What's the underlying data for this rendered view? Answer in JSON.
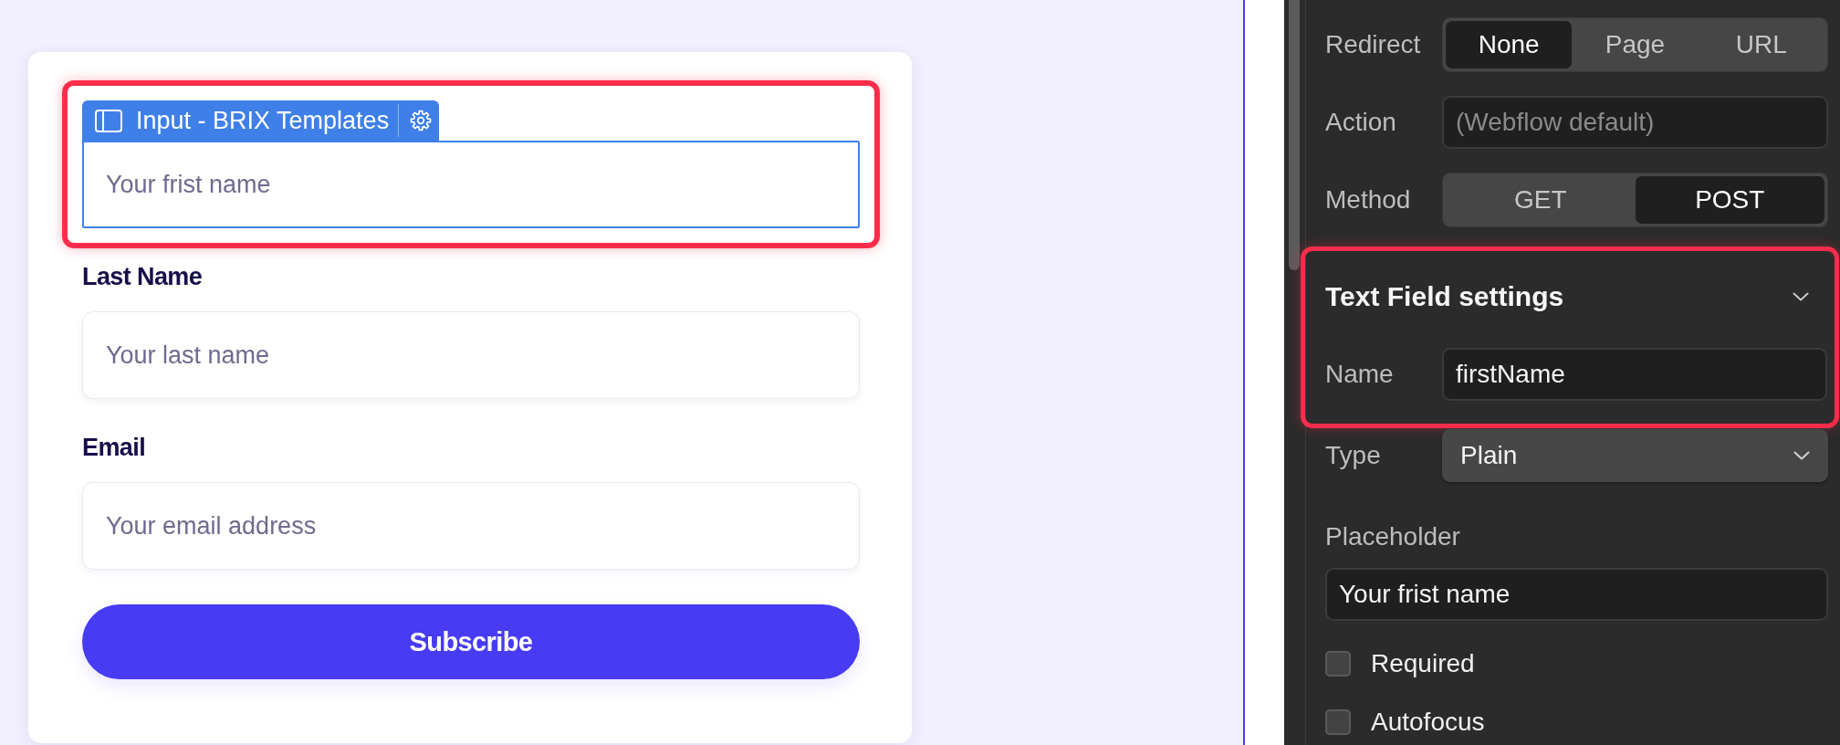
{
  "canvas": {
    "selection_tag": {
      "label": "Input - BRIX Templates"
    },
    "fields": [
      {
        "placeholder": "Your frist name",
        "selected": true,
        "highlighted": true
      },
      {
        "label": "Last Name",
        "placeholder": "Your last name",
        "selected": false,
        "highlighted": false
      },
      {
        "label": "Email",
        "placeholder": "Your email address",
        "selected": false,
        "highlighted": false
      }
    ],
    "submit_button": {
      "label": "Subscribe"
    }
  },
  "settings_panel": {
    "form_rows": [
      {
        "kind": "segmented",
        "label": "Redirect",
        "options": [
          {
            "label": "None",
            "selected": true
          },
          {
            "label": "Page",
            "selected": false
          },
          {
            "label": "URL",
            "selected": false
          }
        ]
      },
      {
        "kind": "input",
        "label": "Action",
        "placeholder": "(Webflow default)"
      },
      {
        "kind": "segmented",
        "label": "Method",
        "options": [
          {
            "label": "GET",
            "selected": false
          },
          {
            "label": "POST",
            "selected": true
          }
        ]
      }
    ],
    "text_field_section": {
      "title": "Text Field settings",
      "highlighted": true,
      "rows": [
        {
          "kind": "input",
          "label": "Name",
          "value": "firstName"
        }
      ]
    },
    "field_rows": [
      {
        "kind": "select",
        "label": "Type",
        "value": "Plain"
      },
      {
        "kind": "stacked_input",
        "label": "Placeholder",
        "value": "Your frist name"
      },
      {
        "kind": "checkbox",
        "label": "Required",
        "checked": false
      },
      {
        "kind": "checkbox",
        "label": "Autofocus",
        "checked": false
      }
    ]
  }
}
